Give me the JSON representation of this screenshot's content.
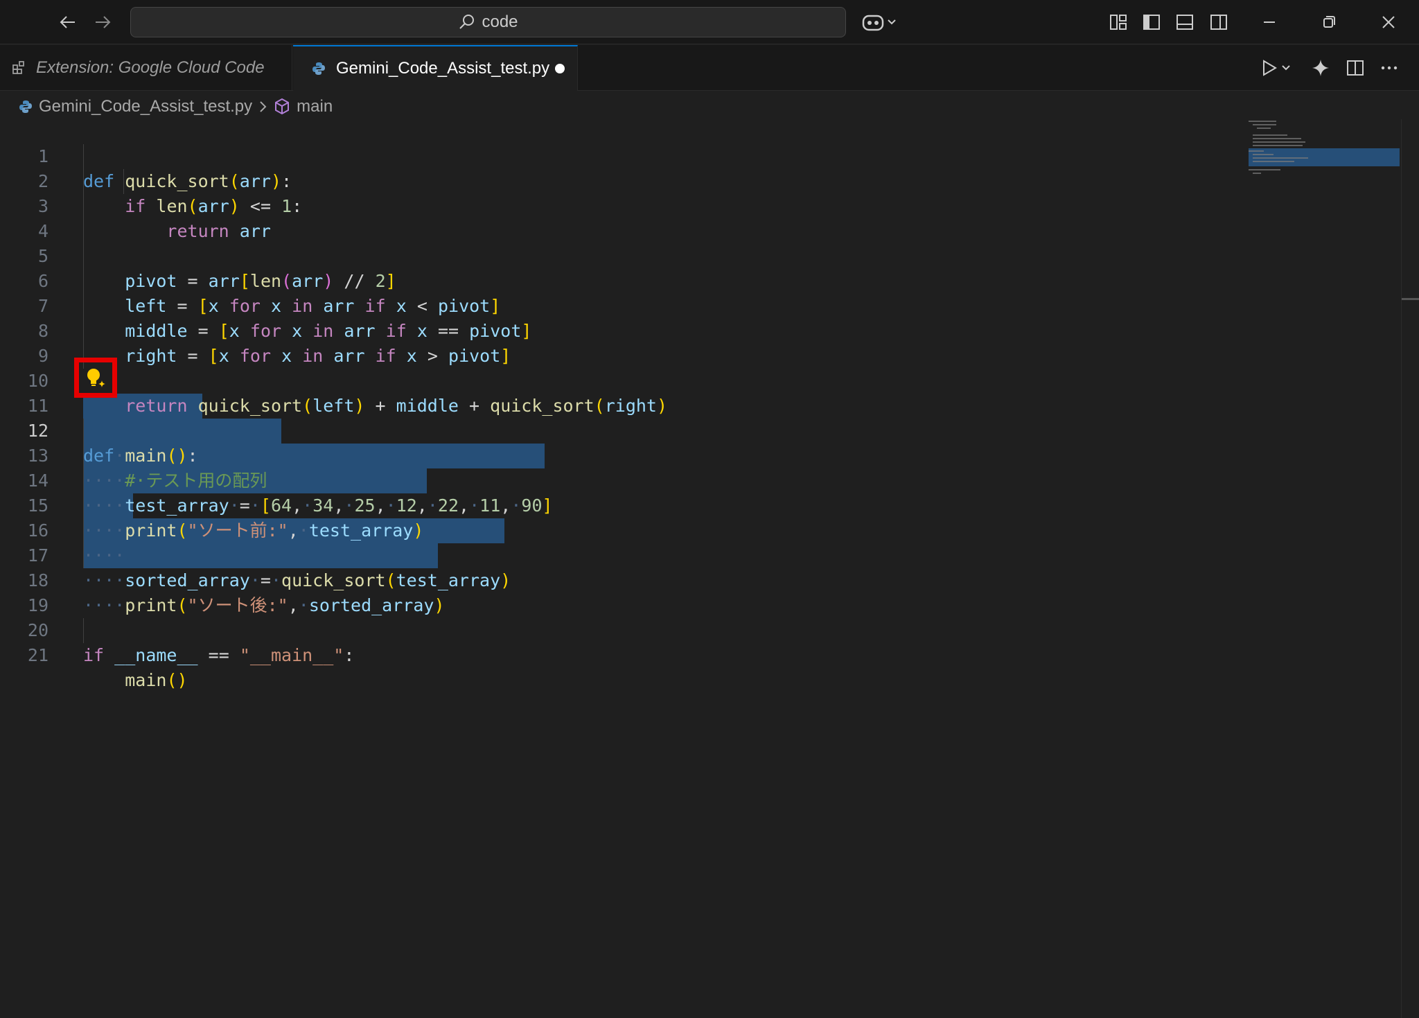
{
  "titlebar": {
    "search_text": "code"
  },
  "tabs": [
    {
      "label": "Extension: Google Cloud Code",
      "active": false
    },
    {
      "label": "Gemini_Code_Assist_test.py",
      "active": true,
      "dirty": true
    }
  ],
  "breadcrumb": {
    "file": "Gemini_Code_Assist_test.py",
    "separator": ">",
    "symbol": "main"
  },
  "editor": {
    "active_line": 12,
    "selection_lines": [
      12,
      18
    ],
    "line_numbers": [
      "1",
      "2",
      "3",
      "4",
      "5",
      "6",
      "7",
      "8",
      "9",
      "10",
      "11",
      "12",
      "13",
      "14",
      "15",
      "16",
      "17",
      "18",
      "19",
      "20",
      "21"
    ],
    "lines": [
      "def quick_sort(arr):",
      "    if len(arr) <= 1:",
      "        return arr",
      "",
      "    pivot = arr[len(arr) // 2]",
      "    left = [x for x in arr if x < pivot]",
      "    middle = [x for x in arr if x == pivot]",
      "    right = [x for x in arr if x > pivot]",
      "",
      "    return quick_sort(left) + middle + quick_sort(right)",
      "",
      "def main():",
      "    # テスト用の配列",
      "    test_array = [64, 34, 25, 12, 22, 11, 90]",
      "    print(\"ソート前:\", test_array)",
      "    ",
      "    sorted_array = quick_sort(test_array)",
      "    print(\"ソート後:\", sorted_array)",
      "",
      "if __name__ == \"__main__\":",
      "    main()"
    ]
  },
  "colors": {
    "accent": "#0078d4",
    "highlight_box": "#e60000",
    "selection": "#264f78",
    "lightbulb": "#ffcc00"
  },
  "icons": {
    "back": "arrow-left-icon",
    "forward": "arrow-right-icon",
    "search": "search-icon",
    "copilot": "copilot-icon",
    "lightbulb": "lightbulb-sparkle-icon"
  }
}
